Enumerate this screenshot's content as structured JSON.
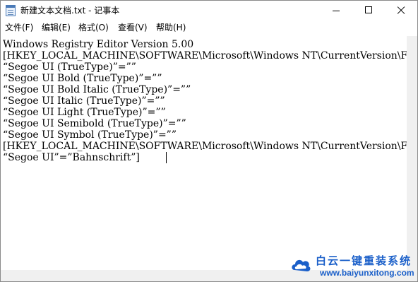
{
  "window": {
    "title": "新建文本文档.txt - 记事本"
  },
  "menu": {
    "items": [
      "文件(F)",
      "编辑(E)",
      "格式(O)",
      "查看(V)",
      "帮助(H)"
    ]
  },
  "editor": {
    "lines": [
      "Windows Registry Editor Version 5.00",
      "[HKEY_LOCAL_MACHINE\\SOFTWARE\\Microsoft\\Windows NT\\CurrentVersion\\Fonts]",
      "“Segoe UI (TrueType)”=””",
      "“Segoe UI Bold (TrueType)”=””",
      "“Segoe UI Bold Italic (TrueType)”=””",
      "“Segoe UI Italic (TrueType)”=””",
      "“Segoe UI Light (TrueType)”=””",
      "“Segoe UI Semibold (TrueType)”=””",
      "“Segoe UI Symbol (TrueType)”=””",
      "[HKEY_LOCAL_MACHINE\\SOFTWARE\\Microsoft\\Windows NT\\CurrentVersion\\FontSub",
      "“Segoe UI”=”Bahnschrift”]"
    ]
  },
  "watermark": {
    "title": "白云一键重装系统",
    "url": "www.baiyunxitong.com"
  },
  "colors": {
    "watermark": "#1a5fc9",
    "scrollbar": "#f0f0f0"
  }
}
